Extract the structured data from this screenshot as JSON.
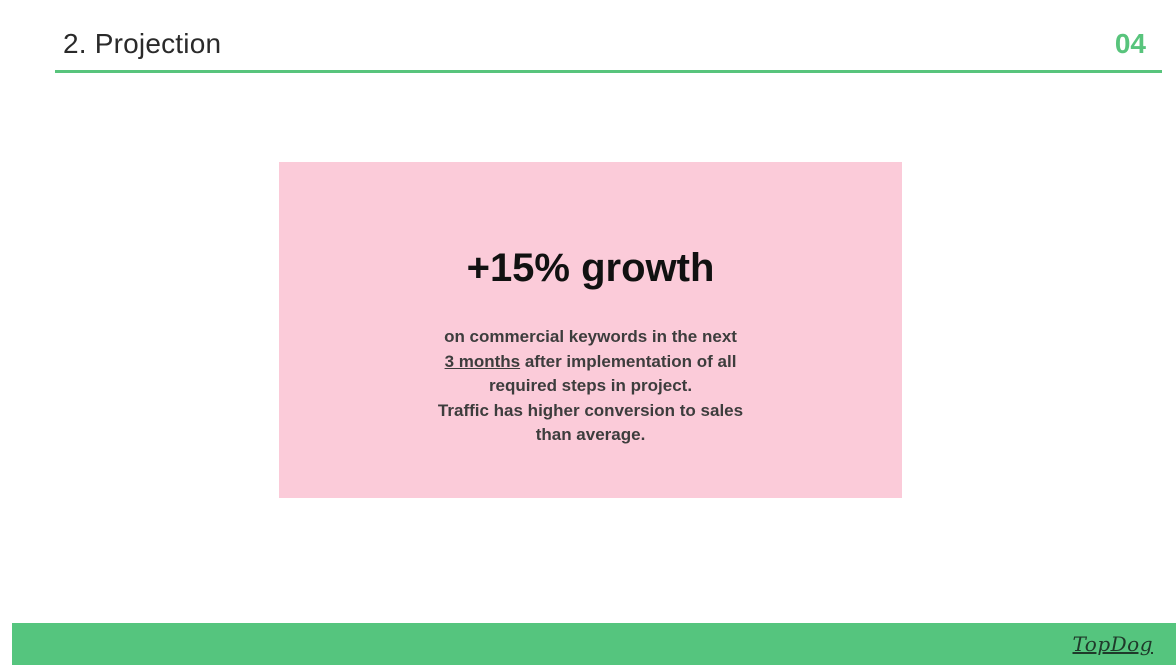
{
  "header": {
    "title": "2. Projection",
    "page_number": "04"
  },
  "highlight": {
    "headline": "+15% growth",
    "lines": [
      "on commercial keywords in the next",
      "3 months",
      " after implementation of all",
      "required steps in project.",
      "Traffic has higher conversion to sales",
      "than average."
    ]
  },
  "footer": {
    "logo": "TopDog"
  },
  "colors": {
    "accent": "#58c47c",
    "box_background": "#fbcbd9",
    "footer_bar": "#55c57e"
  }
}
